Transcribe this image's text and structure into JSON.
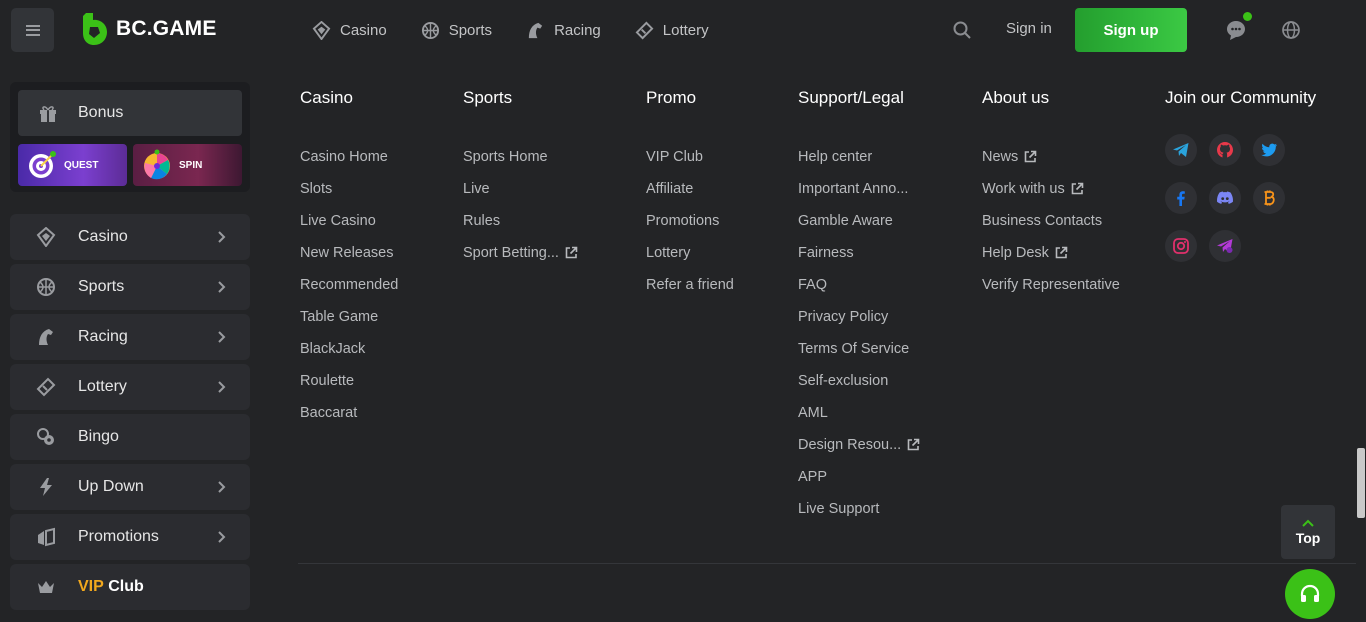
{
  "brand": {
    "name": "BC.GAME",
    "accent": "#3bc117",
    "gold": "#f2a81d"
  },
  "topnav": [
    {
      "label": "Casino",
      "icon": "casino-icon"
    },
    {
      "label": "Sports",
      "icon": "sports-icon"
    },
    {
      "label": "Racing",
      "icon": "racing-icon"
    },
    {
      "label": "Lottery",
      "icon": "lottery-icon"
    }
  ],
  "header": {
    "signin": "Sign in",
    "signup": "Sign up"
  },
  "sidebar": {
    "bonus": "Bonus",
    "quest": "QUEST",
    "spin": "SPIN",
    "items": [
      {
        "label": "Casino",
        "icon": "casino-icon",
        "chevron": true
      },
      {
        "label": "Sports",
        "icon": "sports-icon",
        "chevron": true
      },
      {
        "label": "Racing",
        "icon": "racing-icon",
        "chevron": true
      },
      {
        "label": "Lottery",
        "icon": "lottery-icon",
        "chevron": true
      },
      {
        "label": "Bingo",
        "icon": "bingo-icon",
        "chevron": false
      },
      {
        "label": "Up Down",
        "icon": "lightning-icon",
        "chevron": true
      },
      {
        "label": "Promotions",
        "icon": "promotions-icon",
        "chevron": true
      }
    ],
    "vip_gold": "VIP",
    "vip_white": "Club"
  },
  "footer": {
    "columns": [
      {
        "title": "Casino",
        "links": [
          {
            "label": "Casino Home"
          },
          {
            "label": "Slots"
          },
          {
            "label": "Live Casino"
          },
          {
            "label": "New Releases"
          },
          {
            "label": "Recommended"
          },
          {
            "label": "Table Game"
          },
          {
            "label": "BlackJack"
          },
          {
            "label": "Roulette"
          },
          {
            "label": "Baccarat"
          }
        ]
      },
      {
        "title": "Sports",
        "links": [
          {
            "label": "Sports Home"
          },
          {
            "label": "Live"
          },
          {
            "label": "Rules"
          },
          {
            "label": "Sport Betting...",
            "external": true
          }
        ]
      },
      {
        "title": "Promo",
        "links": [
          {
            "label": "VIP Club"
          },
          {
            "label": "Affiliate"
          },
          {
            "label": "Promotions"
          },
          {
            "label": "Lottery"
          },
          {
            "label": "Refer a friend"
          }
        ]
      },
      {
        "title": "Support/Legal",
        "links": [
          {
            "label": "Help center"
          },
          {
            "label": "Important Anno..."
          },
          {
            "label": "Gamble Aware"
          },
          {
            "label": "Fairness"
          },
          {
            "label": "FAQ"
          },
          {
            "label": "Privacy Policy"
          },
          {
            "label": "Terms Of Service"
          },
          {
            "label": "Self-exclusion"
          },
          {
            "label": "AML"
          },
          {
            "label": "Design Resou...",
            "external": true
          },
          {
            "label": "APP"
          },
          {
            "label": "Live Support"
          }
        ]
      },
      {
        "title": "About us",
        "links": [
          {
            "label": "News",
            "external": true
          },
          {
            "label": "Work with us",
            "external": true
          },
          {
            "label": "Business Contacts"
          },
          {
            "label": "Help Desk",
            "external": true
          },
          {
            "label": "Verify Representative"
          }
        ]
      }
    ],
    "community_title": "Join our Community",
    "social": [
      {
        "icon": "telegram-icon",
        "color": "#2aa3dc"
      },
      {
        "icon": "github-icon",
        "color": "#e8394a"
      },
      {
        "icon": "twitter-icon",
        "color": "#1d9bf0"
      },
      {
        "icon": "facebook-icon",
        "color": "#1877f2"
      },
      {
        "icon": "discord-icon",
        "color": "#7b86f5"
      },
      {
        "icon": "bitcoin-icon",
        "color": "#f7931a"
      },
      {
        "icon": "instagram-icon",
        "color": "#e1306c"
      },
      {
        "icon": "send-icon",
        "color": "#b33ad6"
      }
    ]
  },
  "top_button": "Top"
}
